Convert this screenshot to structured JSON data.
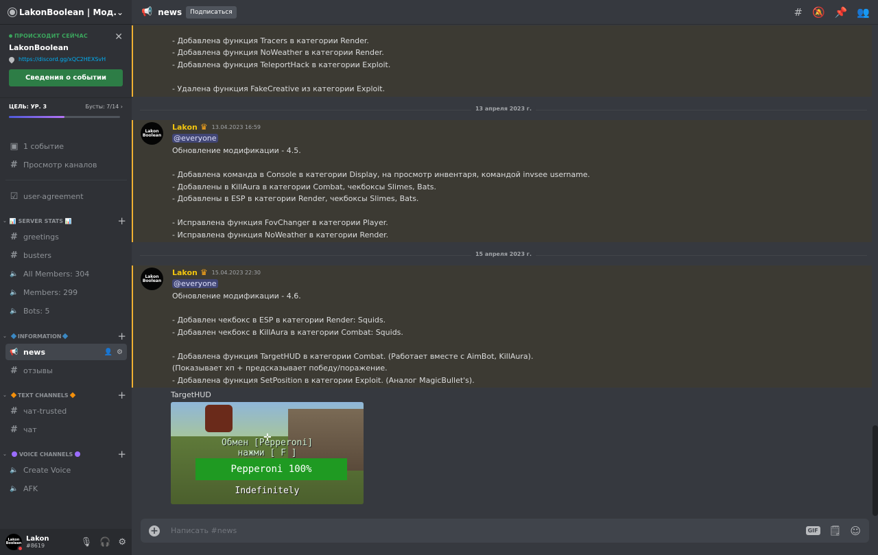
{
  "server": {
    "name": "LakonBoolean | Мод..."
  },
  "event": {
    "live_label": "ПРОИСХОДИТ СЕЙЧАС",
    "title": "LakonBoolean",
    "link": "https://discord.gg/xQC2HEXSvH",
    "button_label": "Сведения о событии",
    "close_glyph": "✕"
  },
  "boost": {
    "goal": "ЦЕЛЬ: УР. 3",
    "count": "Бусты: 7/14 ›",
    "progress": 0.5
  },
  "sidebar": {
    "quick": [
      {
        "label": "1 событие",
        "icon": "calendar-icon",
        "glyph": "▣"
      },
      {
        "label": "Просмотр каналов",
        "icon": "browse-channels-icon",
        "glyph": "#"
      }
    ],
    "pinned": [
      {
        "label": "user-agreement",
        "icon": "rules-icon",
        "glyph": "☑"
      }
    ],
    "categories": [
      {
        "name": "📊 SERVER STATS 📊",
        "channels": [
          {
            "label": "greetings",
            "glyph": "#"
          },
          {
            "label": "busters",
            "glyph": "#"
          },
          {
            "label": "All Members: 304",
            "glyph": "🔈"
          },
          {
            "label": "Members: 299",
            "glyph": "🔈"
          },
          {
            "label": "Bots: 5",
            "glyph": "🔈"
          }
        ]
      },
      {
        "name": "INFORMATION",
        "channels": [
          {
            "label": "news",
            "glyph": "📢"
          },
          {
            "label": "отзывы",
            "glyph": "#"
          }
        ]
      },
      {
        "name": "TEXT CHANNELS",
        "channels": [
          {
            "label": "чат-trusted",
            "glyph": "#"
          },
          {
            "label": "чат",
            "glyph": "#"
          }
        ]
      },
      {
        "name": "VOICE CHANNELS",
        "channels": [
          {
            "label": "Create Voice",
            "glyph": "🔈"
          },
          {
            "label": "AFK",
            "glyph": "🔈"
          }
        ]
      }
    ]
  },
  "user": {
    "name": "Lakon",
    "tag": "#8619",
    "avatar_text": "Lakon Boolean"
  },
  "channel": {
    "title": "news",
    "follow_label": "Подписаться"
  },
  "messages": {
    "top_lines": [
      "- Добавлена функция Tracers в категории Render.",
      "- Добавлена функция NoWeather в категории Render.",
      "- Добавлена функция TeleportHack в категории Exploit.",
      "- Удалена функция FakeCreative из категории Exploit."
    ],
    "date1": "13 апреля 2023 г.",
    "msg1": {
      "author": "Lakon",
      "timestamp": "13.04.2023 16:59",
      "mention": "@everyone",
      "lines": [
        "Обновление модификации - 4.5.",
        "- Добавлена команда в Console в категории Display, на просмотр инвентаря, командой invsee username.",
        "- Добавлены в KillAura в категории Combat, чекбоксы Slimes, Bats.",
        "- Добавлены в ESP в категории Render, чекбоксы Slimes, Bats.",
        "- Исправлена функция FovChanger в категории Player.",
        "- Исправлена функция NoWeather в категории Render."
      ]
    },
    "date2": "15 апреля 2023 г.",
    "msg2": {
      "author": "Lakon",
      "timestamp": "15.04.2023 22:30",
      "mention": "@everyone",
      "lines": [
        "Обновление модификации - 4.6.",
        "- Добавлен чекбокс в ESP в категории Render: Squids.",
        "- Добавлен чекбокс в KillAura в категории Combat: Squids.",
        "- Добавлена функция TargetHUD в категории Combat. (Работает вместе с AimBot, KillAura).",
        "(Показывает хп + предсказывает победу/поражение.",
        "- Добавлена функция SetPosition в категории Exploit. (Аналог MagicBullet's).",
        "TargetHUD"
      ]
    },
    "attachment": {
      "line1": "Обмен [Pepperoni]",
      "line2": "нажми [ F ]",
      "bar": "Pepperoni 100%",
      "line3": "Indefinitely"
    }
  },
  "composer": {
    "placeholder": "Написать #news",
    "gif": "GIF"
  },
  "colors": {
    "accent": "#f0b132",
    "author": "#f1c40f",
    "button": "#2d7d46"
  }
}
